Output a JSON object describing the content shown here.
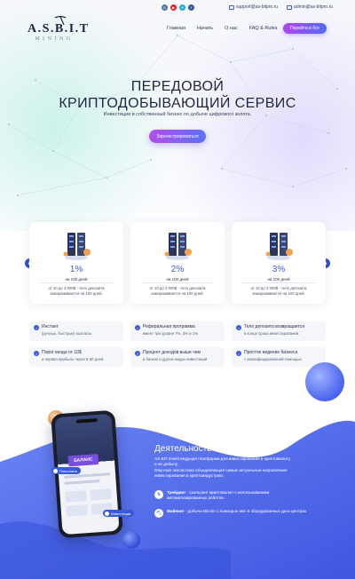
{
  "header": {
    "logo_main": "A.S.B.I.T",
    "logo_sub": "MINING",
    "socials": [
      {
        "icon": "vk-icon",
        "color": "#4a76a8",
        "glyph": "В"
      },
      {
        "icon": "youtube-icon",
        "color": "#e62117",
        "glyph": "▶"
      },
      {
        "icon": "telegram-icon",
        "color": "#2ca5e0",
        "glyph": "✈"
      },
      {
        "icon": "facebook-icon",
        "color": "#3b5998",
        "glyph": "f"
      }
    ],
    "support_email": "support@as-bitpro.ru",
    "admin_email": "admin@as-bitpro.ru",
    "nav": [
      "Главная",
      "Начать",
      "О нас",
      "FAQ & Rules"
    ],
    "login_label": "Перейти в бот"
  },
  "hero": {
    "title_line1": "ПЕРЕДОВОЙ",
    "title_line2": "КРИПТОДОБЫВАЮЩИЙ СЕРВИС",
    "subtitle": "Инвестиции в собственный бизнес по добыче цифрового золота.",
    "register_label": "Зарегистрироваться"
  },
  "plans": [
    {
      "percent": "1%",
      "period": "на 100 дней",
      "desc_line1": "от 10 до 3 000$ - тело депозита",
      "desc_line2": "замораживается на 100 дней."
    },
    {
      "percent": "2%",
      "period": "на 100 дней",
      "desc_line1": "от 10 до 3 000$ - тело депозита",
      "desc_line2": "замораживается на 100 дней."
    },
    {
      "percent": "3%",
      "period": "на 100 дней",
      "desc_line1": "от 10 до 3 000$ - тело депозита",
      "desc_line2": "замораживается на 100 дней."
    }
  ],
  "features": [
    {
      "title": "Инстант",
      "desc": "(ручные, быстрые) выплаты"
    },
    {
      "title": "Реферальная программа",
      "desc": "имеет три уровня 7%, 3% и 1%"
    },
    {
      "title": "Тело депозита возвращается",
      "desc": "в конце срока инвестирования."
    },
    {
      "title": "Порог входа от 10$",
      "desc": "и первая прибыль через 5-30 дней."
    },
    {
      "title": "Процент доходов выше чем",
      "desc": "в банках и других видах инвестиций"
    },
    {
      "title": "Простое ведение бизнеса",
      "desc": "с квалифицированной помощью"
    }
  ],
  "company": {
    "title": "Деятельность компании",
    "text_lines": [
      "AS-BIT invest ведущая платформа для инвестирования в криптовалюту",
      "и ее добычу.",
      "Опытная экосистема объединяющая самые актуальные направления",
      "инвестирования в криптоиндустрию:"
    ],
    "bullets": [
      {
        "bold": "Трейдинг",
        "line1": " - скальпинг криптовалют с использованием",
        "line2": "автоматизированных роботов."
      },
      {
        "bold": "Майнинг",
        "line1": " - добыча Bitcoin с помощью asic в оборудованных дата центрах",
        "line2": ""
      }
    ]
  },
  "phone": {
    "balance": "БАЛАНС",
    "chip_top": "Пополнить",
    "chip_bottom": "Инвестиции"
  },
  "colors": {
    "accent": "#3a5bd9",
    "button_gradient_start": "#b045f0",
    "button_gradient_end": "#4f6cf5",
    "wave": "#4d68ee"
  }
}
